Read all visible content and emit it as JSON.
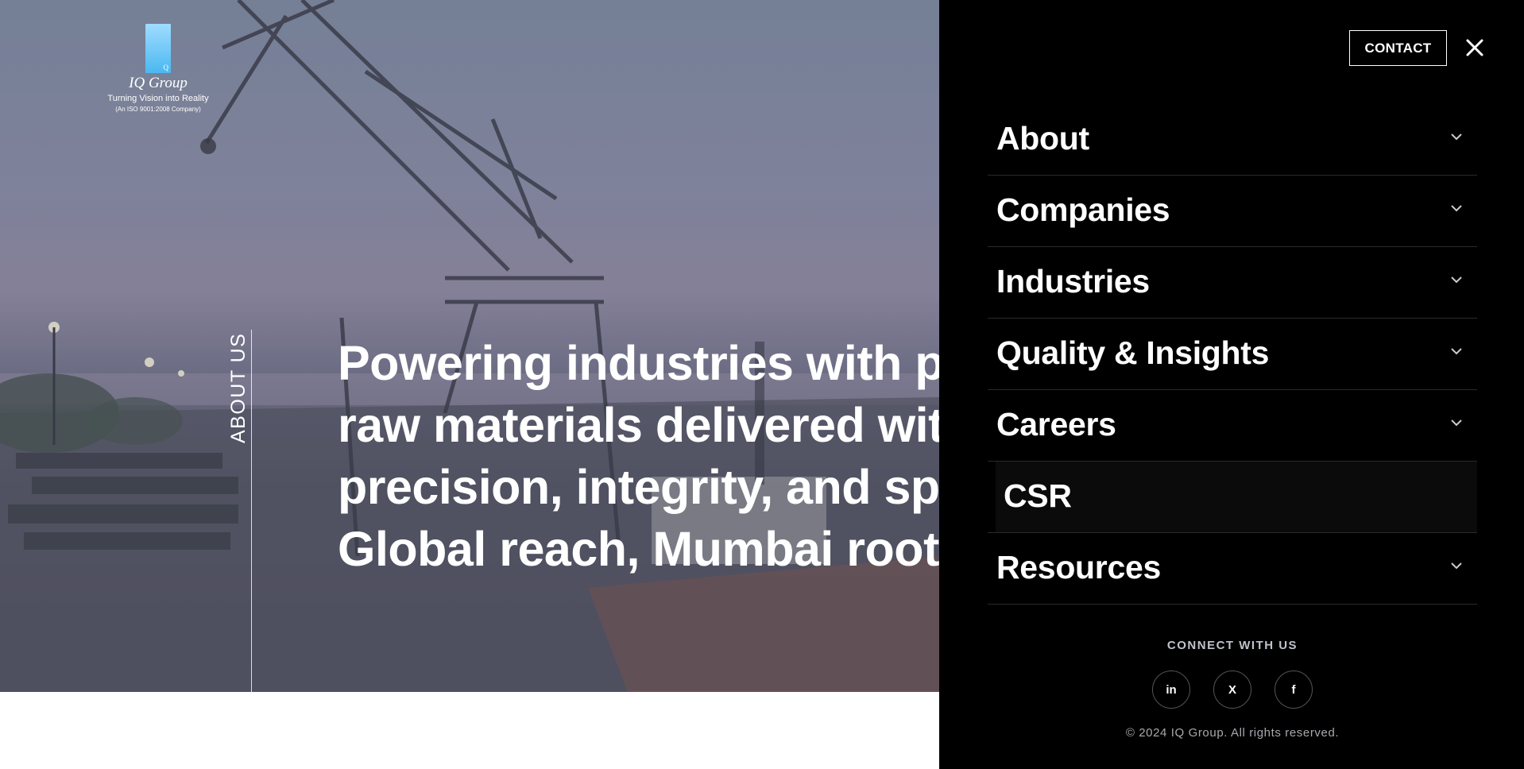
{
  "logo": {
    "mark_letter": "Q",
    "name": "IQ Group",
    "tagline": "Turning Vision into Reality",
    "iso": "(An ISO 9001:2008 Company)"
  },
  "hero": {
    "section_label": "ABOUT US",
    "headline_lines": [
      "Powering industries with pr",
      "raw materials delivered wit",
      "precision, integrity, and spe",
      "Global reach, Mumbai roots"
    ]
  },
  "panel": {
    "contact_label": "CONTACT",
    "close_icon": "close-icon",
    "menu": [
      {
        "label": "About",
        "icon": "chevron-down-icon"
      },
      {
        "label": "Companies",
        "icon": "chevron-down-icon"
      },
      {
        "label": "Industries",
        "icon": "chevron-down-icon"
      },
      {
        "label": "Quality & Insights",
        "icon": "chevron-down-icon"
      },
      {
        "label": "Careers",
        "icon": "chevron-down-icon"
      },
      {
        "label": "CSR"
      },
      {
        "label": "Resources",
        "icon": "chevron-down-icon"
      }
    ],
    "connect_label": "CONNECT WITH US",
    "socials": [
      {
        "label": "in",
        "icon": "linkedin-icon"
      },
      {
        "label": "X",
        "icon": "x-icon"
      },
      {
        "label": "f",
        "icon": "facebook-icon"
      }
    ],
    "copyright": "© 2024 IQ Group. All rights reserved."
  },
  "colors": {
    "panel_bg": "#000000",
    "logo_blue": "#4bb8f0",
    "text": "#ffffff"
  }
}
